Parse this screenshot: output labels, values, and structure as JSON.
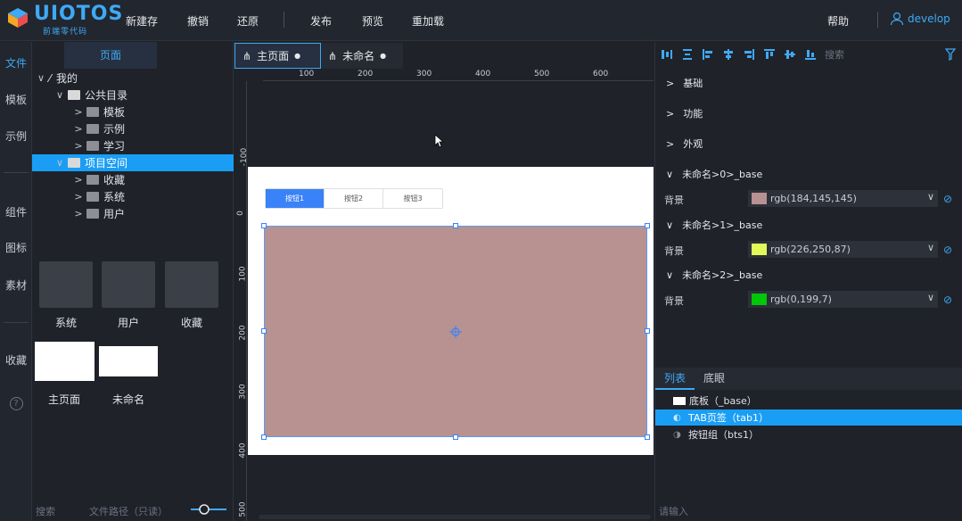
{
  "app": {
    "logo": "UIOTOS",
    "logo_sub": "前端零代码"
  },
  "menu": [
    "新建存",
    "撤销",
    "还原",
    "发布",
    "预览",
    "重加载"
  ],
  "header": {
    "help": "帮助",
    "user": "develop"
  },
  "rail": {
    "items": [
      "文件",
      "模板",
      "示例",
      "组件",
      "图标",
      "素材",
      "收藏"
    ],
    "active": "文件",
    "help_glyph": "?"
  },
  "leftpanel": {
    "tab": "页面",
    "tree": [
      {
        "label": "我的",
        "level": 0,
        "expanded": true,
        "folder": false
      },
      {
        "label": "公共目录",
        "level": 1,
        "expanded": true,
        "folder": "light"
      },
      {
        "label": "模板",
        "level": 2,
        "expanded": false,
        "folder": "dark"
      },
      {
        "label": "示例",
        "level": 2,
        "expanded": false,
        "folder": "dark"
      },
      {
        "label": "学习",
        "level": 2,
        "expanded": false,
        "folder": "dark"
      },
      {
        "label": "项目空间",
        "level": 1,
        "expanded": true,
        "folder": "light",
        "selected": true
      },
      {
        "label": "收藏",
        "level": 2,
        "expanded": false,
        "folder": "dark"
      },
      {
        "label": "系统",
        "level": 2,
        "expanded": false,
        "folder": "dark"
      },
      {
        "label": "用户",
        "level": 2,
        "expanded": false,
        "folder": "dark"
      }
    ],
    "folders": [
      "系统",
      "用户",
      "收藏"
    ],
    "pages": [
      "主页面",
      "未命名"
    ],
    "footer_search": "搜索",
    "footer_path": "文件路径（只读）"
  },
  "doc_tabs": [
    "主页面",
    "未命名"
  ],
  "ruler": {
    "h_ticks": [
      "100",
      "200",
      "300",
      "400",
      "500",
      "600"
    ],
    "v_ticks": [
      "-100",
      "0",
      "100",
      "200",
      "300",
      "400",
      "500"
    ]
  },
  "canvas": {
    "tab_buttons": [
      "按钮1",
      "按钮2",
      "按钮3"
    ],
    "active_tab": 0,
    "selection_color": "#b89191"
  },
  "rightpanel": {
    "search": "搜索",
    "sections": [
      "基础",
      "功能",
      "外观"
    ],
    "props": [
      {
        "group": "未命名>0>_base",
        "label": "背景",
        "value": "rgb(184,145,145)",
        "color": "#b89191"
      },
      {
        "group": "未命名>1>_base",
        "label": "背景",
        "value": "rgb(226,250,87)",
        "color": "#e2fa57"
      },
      {
        "group": "未命名>2>_base",
        "label": "背景",
        "value": "rgb(0,199,7)",
        "color": "#00c707"
      }
    ],
    "list_tabs": [
      "列表",
      "底眼"
    ],
    "list": [
      {
        "label": "底板（_base）",
        "icon": "base-icon"
      },
      {
        "label": "TAB页签（tab1）",
        "icon": "tab-icon",
        "selected": true
      },
      {
        "label": "按钮组（bts1）",
        "icon": "button-group-icon"
      }
    ],
    "footer_input": "请输入"
  },
  "colors": {
    "accent": "#3fa9f5",
    "selected": "#1a9ef5",
    "tab_active": "#3a82f7"
  }
}
